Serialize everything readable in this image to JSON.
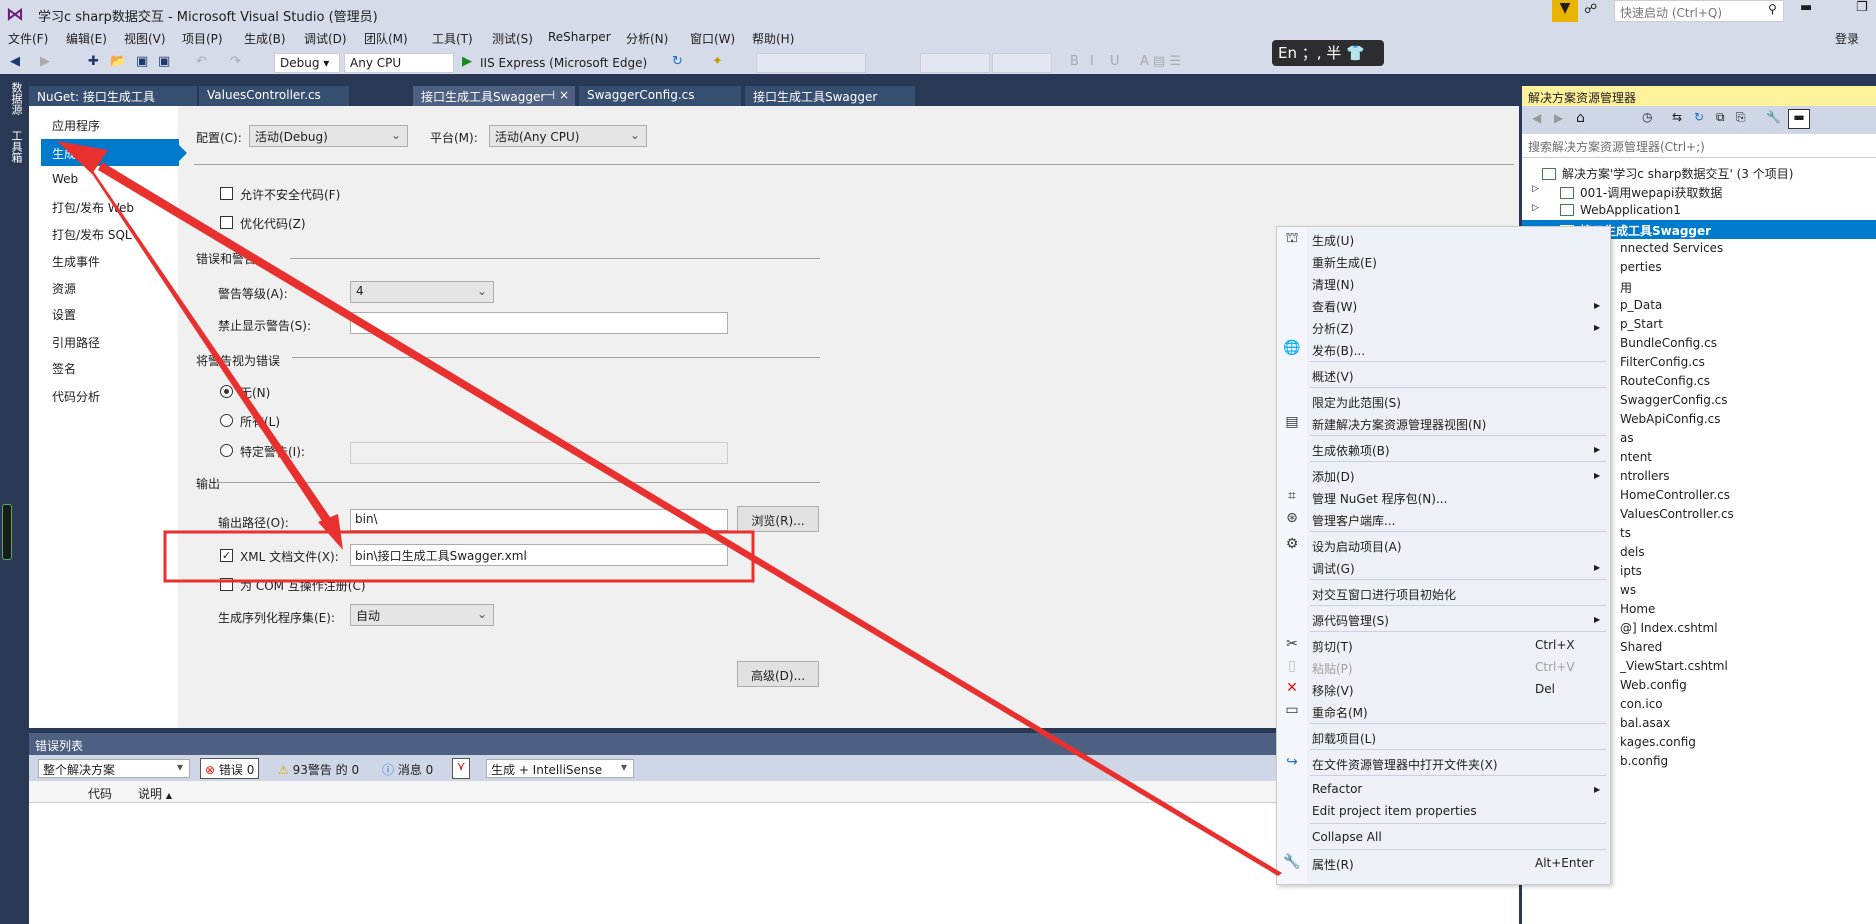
{
  "window": {
    "title": "学习c sharp数据交互 - Microsoft Visual Studio (管理员)",
    "quick_launch_placeholder": "快速启动 (Ctrl+Q)",
    "login": "登录",
    "ime": "En ；, 半"
  },
  "menu": [
    "文件(F)",
    "编辑(E)",
    "视图(V)",
    "项目(P)",
    "生成(B)",
    "调试(D)",
    "团队(M)",
    "工具(T)",
    "测试(S)",
    "ReSharper",
    "分析(N)",
    "窗口(W)",
    "帮助(H)"
  ],
  "toolbar": {
    "config": "Debug",
    "platform": "Any CPU",
    "run": "IIS Express (Microsoft Edge)"
  },
  "left_strip": [
    "数据源",
    "工具箱"
  ],
  "tabs": [
    {
      "label": "NuGet: 接口生成工具Swagger"
    },
    {
      "label": "ValuesController.cs"
    },
    {
      "label": "接口生成工具Swagger",
      "active": true
    },
    {
      "label": "SwaggerConfig.cs"
    },
    {
      "label": "接口生成工具Swagger"
    }
  ],
  "nav": [
    "应用程序",
    "生成",
    "Web",
    "打包/发布 Web",
    "打包/发布 SQL",
    "生成事件",
    "资源",
    "设置",
    "引用路径",
    "签名",
    "代码分析"
  ],
  "nav_selected": "生成",
  "props": {
    "config_label": "配置(C):",
    "config_value": "活动(Debug)",
    "platform_label": "平台(M):",
    "platform_value": "活动(Any CPU)",
    "unsafe": {
      "label": "允许不安全代码(F)",
      "checked": false
    },
    "optimize": {
      "label": "优化代码(Z)",
      "checked": false
    },
    "errors_section": "错误和警告",
    "warning_level_label": "警告等级(A):",
    "warning_level": "4",
    "suppress_label": "禁止显示警告(S):",
    "suppress_value": "",
    "treat_section": "将警告视为错误",
    "treat_none": "无(N)",
    "treat_all": "所有(L)",
    "treat_specific": "特定警告(I):",
    "treat_selected": "none",
    "output_section": "输出",
    "output_path_label": "输出路径(O):",
    "output_path": "bin\\",
    "browse": "浏览(R)...",
    "xml_doc": {
      "label": "XML 文档文件(X):",
      "checked": true,
      "value": "bin\\接口生成工具Swagger.xml"
    },
    "com": {
      "label": "为 COM 互操作注册(C)",
      "checked": false
    },
    "serialization_label": "生成序列化程序集(E):",
    "serialization_value": "自动",
    "advanced": "高级(D)..."
  },
  "error_list": {
    "title": "错误列表",
    "scope": "整个解决方案",
    "errors": "错误 0",
    "warnings": "93警告 的 0",
    "messages": "消息 0",
    "source": "生成 + IntelliSense",
    "col_code": "代码",
    "col_desc": "说明"
  },
  "solution_explorer": {
    "title": "解决方案资源管理器",
    "search_placeholder": "搜索解决方案资源管理器(Ctrl+;)",
    "items": [
      {
        "label": "解决方案'学习c sharp数据交互' (3 个项目)",
        "level": 0
      },
      {
        "label": "001-调用wepapi获取数据",
        "level": 1
      },
      {
        "label": "WebApplication1",
        "level": 1
      },
      {
        "label": "接口生成工具Swagger",
        "level": 1,
        "selected": true
      },
      {
        "label": "nnected Services",
        "level": 2
      },
      {
        "label": "perties",
        "level": 2
      },
      {
        "label": "用",
        "level": 2
      },
      {
        "label": "p_Data",
        "level": 2
      },
      {
        "label": "p_Start",
        "level": 2
      },
      {
        "label": "BundleConfig.cs",
        "level": 3
      },
      {
        "label": "FilterConfig.cs",
        "level": 3
      },
      {
        "label": "RouteConfig.cs",
        "level": 3
      },
      {
        "label": "SwaggerConfig.cs",
        "level": 3
      },
      {
        "label": "WebApiConfig.cs",
        "level": 3
      },
      {
        "label": "as",
        "level": 2
      },
      {
        "label": "ntent",
        "level": 2
      },
      {
        "label": "ntrollers",
        "level": 2
      },
      {
        "label": "HomeController.cs",
        "level": 3
      },
      {
        "label": "ValuesController.cs",
        "level": 3
      },
      {
        "label": "ts",
        "level": 2
      },
      {
        "label": "dels",
        "level": 2
      },
      {
        "label": "ipts",
        "level": 2
      },
      {
        "label": "ws",
        "level": 2
      },
      {
        "label": "Home",
        "level": 3
      },
      {
        "label": "@] Index.cshtml",
        "level": 3
      },
      {
        "label": "Shared",
        "level": 3
      },
      {
        "label": "_ViewStart.cshtml",
        "level": 3
      },
      {
        "label": "Web.config",
        "level": 3
      },
      {
        "label": "con.ico",
        "level": 2
      },
      {
        "label": "bal.asax",
        "level": 2
      },
      {
        "label": "kages.config",
        "level": 2
      },
      {
        "label": "b.config",
        "level": 2
      }
    ]
  },
  "context_menu": [
    {
      "label": "生成(U)",
      "icon": "build-icon"
    },
    {
      "label": "重新生成(E)"
    },
    {
      "label": "清理(N)"
    },
    {
      "label": "查看(W)",
      "submenu": true
    },
    {
      "label": "分析(Z)",
      "submenu": true
    },
    {
      "label": "发布(B)...",
      "icon": "publish-globe-icon",
      "sep_after": true
    },
    {
      "label": "概述(V)",
      "sep_after": true
    },
    {
      "label": "限定为此范围(S)"
    },
    {
      "label": "新建解决方案资源管理器视图(N)",
      "icon": "new-view-icon",
      "sep_after": true
    },
    {
      "label": "生成依赖项(B)",
      "submenu": true,
      "sep_after": true
    },
    {
      "label": "添加(D)",
      "submenu": true
    },
    {
      "label": "管理 NuGet 程序包(N)...",
      "icon": "nuget-icon"
    },
    {
      "label": "管理客户端库...",
      "icon": "client-lib-icon",
      "sep_after": true
    },
    {
      "label": "设为启动项目(A)",
      "icon": "gear-icon"
    },
    {
      "label": "调试(G)",
      "submenu": true,
      "sep_after": true
    },
    {
      "label": "对交互窗口进行项目初始化",
      "sep_after": true
    },
    {
      "label": "源代码管理(S)",
      "submenu": true,
      "sep_after": true
    },
    {
      "label": "剪切(T)",
      "icon": "scissors-icon",
      "shortcut": "Ctrl+X"
    },
    {
      "label": "粘贴(P)",
      "icon": "paste-icon",
      "shortcut": "Ctrl+V",
      "disabled": true
    },
    {
      "label": "移除(V)",
      "icon": "remove-x-icon",
      "shortcut": "Del"
    },
    {
      "label": "重命名(M)",
      "icon": "rename-icon",
      "sep_after": true
    },
    {
      "label": "卸载项目(L)",
      "sep_after": true
    },
    {
      "label": "在文件资源管理器中打开文件夹(X)",
      "icon": "open-folder-arrow-icon",
      "sep_after": true
    },
    {
      "label": "Refactor",
      "submenu": true
    },
    {
      "label": "Edit project item properties",
      "sep_after": true
    },
    {
      "label": "Collapse All",
      "sep_after": true
    },
    {
      "label": "属性(R)",
      "icon": "wrench-icon",
      "shortcut": "Alt+Enter"
    }
  ],
  "colors": {
    "accent": "#007acc",
    "annotation": "#e8302f",
    "se_header": "#fff29d"
  }
}
